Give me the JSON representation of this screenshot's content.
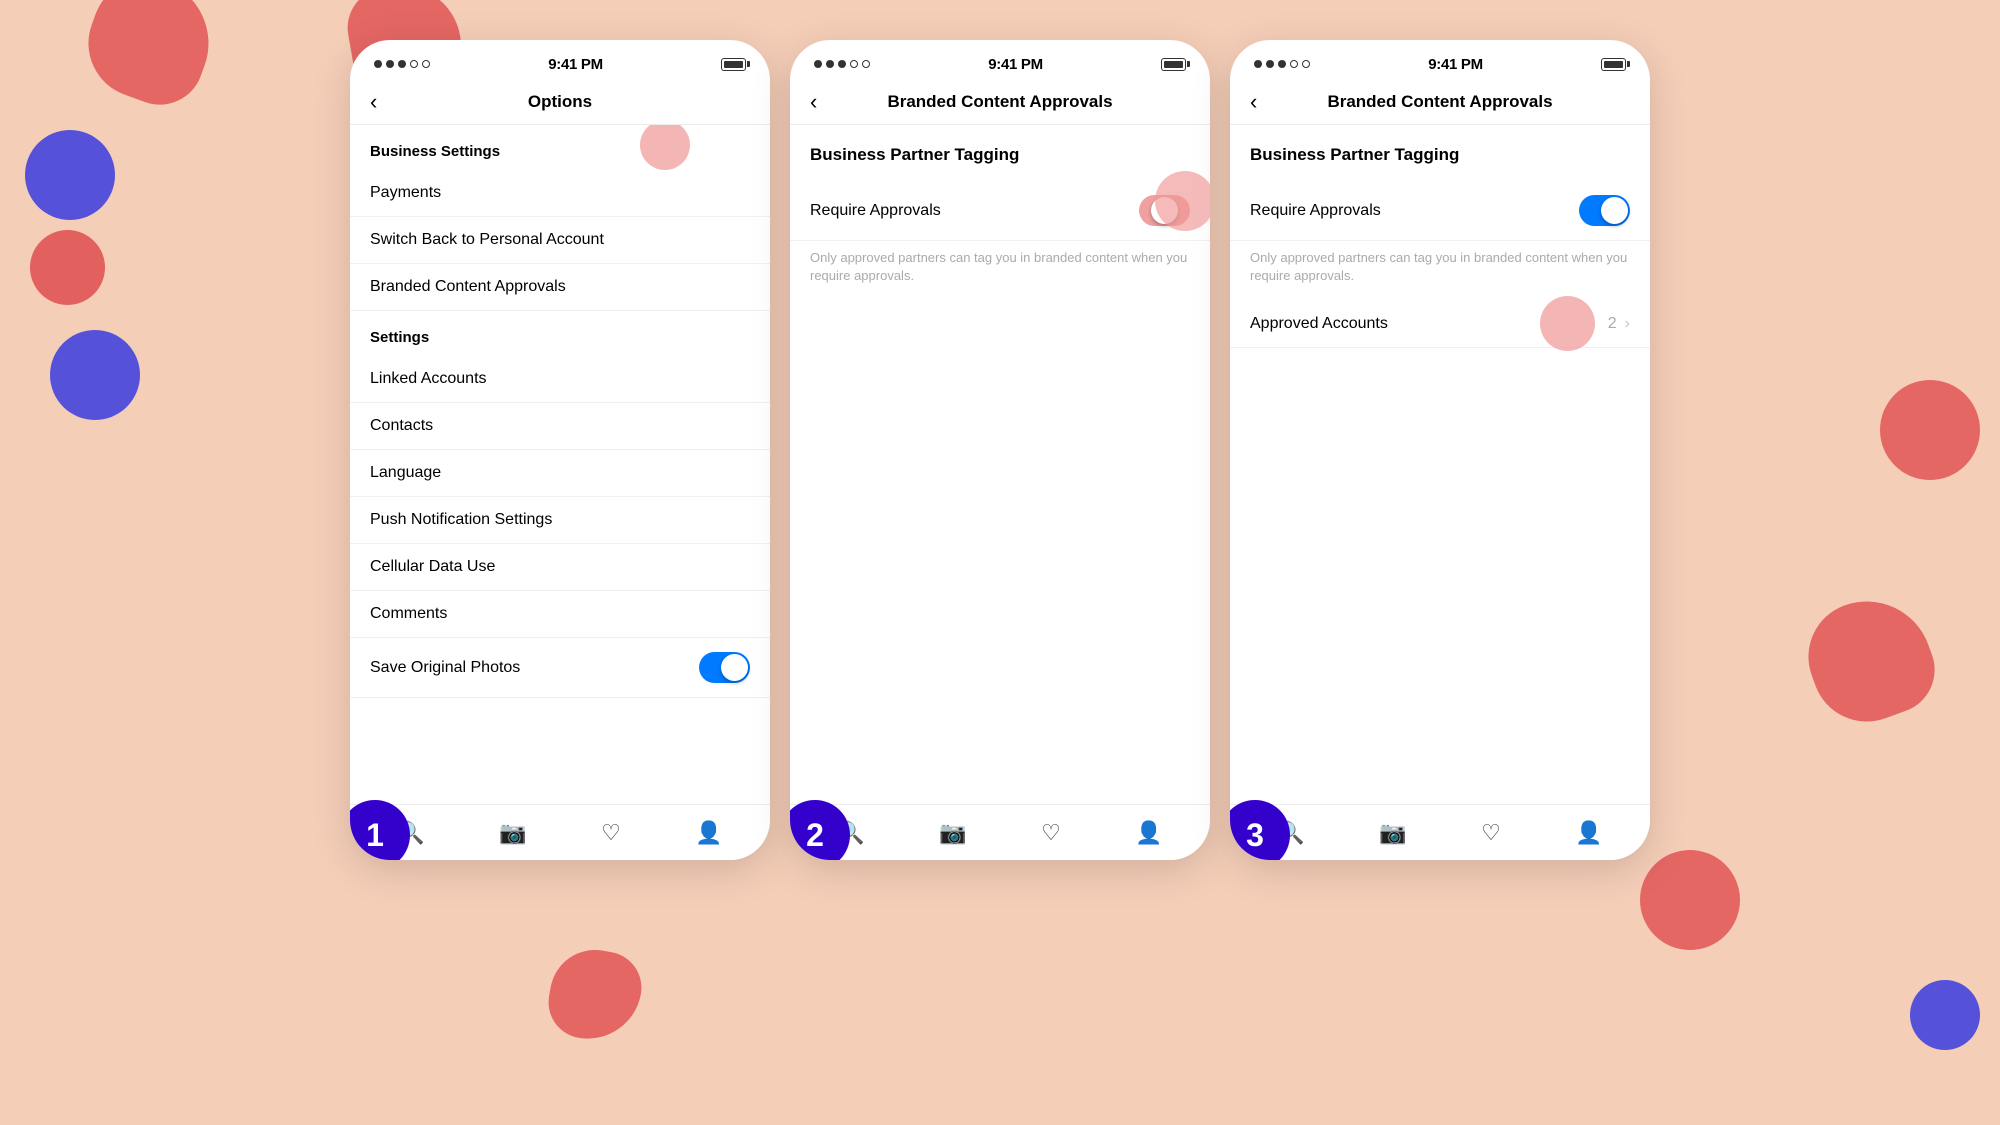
{
  "background": {
    "color": "#f5ceb8"
  },
  "phones": [
    {
      "id": "phone1",
      "step": "1",
      "statusBar": {
        "dots": [
          "filled",
          "filled",
          "filled",
          "empty",
          "empty"
        ],
        "time": "9:41 PM",
        "battery": "full"
      },
      "navTitle": "Options",
      "showBack": true,
      "sections": [
        {
          "type": "section-header",
          "label": "Business Settings"
        },
        {
          "type": "menu-item",
          "label": "Payments"
        },
        {
          "type": "menu-item",
          "label": "Switch Back to Personal Account"
        },
        {
          "type": "menu-item",
          "label": "Branded Content Approvals"
        },
        {
          "type": "section-header",
          "label": "Settings"
        },
        {
          "type": "menu-item",
          "label": "Linked Accounts"
        },
        {
          "type": "menu-item",
          "label": "Contacts"
        },
        {
          "type": "menu-item",
          "label": "Language"
        },
        {
          "type": "menu-item",
          "label": "Push Notification Settings"
        },
        {
          "type": "menu-item",
          "label": "Cellular Data Use"
        },
        {
          "type": "menu-item",
          "label": "Comments"
        },
        {
          "type": "menu-item-toggle",
          "label": "Save Original Photos",
          "toggleState": "on"
        }
      ],
      "tabBar": [
        "search",
        "camera",
        "heart",
        "person"
      ]
    },
    {
      "id": "phone2",
      "step": "2",
      "statusBar": {
        "dots": [
          "filled",
          "filled",
          "filled",
          "empty",
          "empty"
        ],
        "time": "9:41 PM",
        "battery": "full"
      },
      "navTitle": "Branded Content Approvals",
      "showBack": true,
      "bcaSectionTitle": "Business Partner Tagging",
      "requireApprovals": {
        "label": "Require Approvals",
        "toggleState": "half"
      },
      "description": "Only approved partners can tag you in branded content when you require approvals.",
      "tabBar": [
        "search",
        "camera",
        "heart",
        "person"
      ]
    },
    {
      "id": "phone3",
      "step": "3",
      "statusBar": {
        "dots": [
          "filled",
          "filled",
          "filled",
          "empty",
          "empty"
        ],
        "time": "9:41 PM",
        "battery": "full"
      },
      "navTitle": "Branded Content Approvals",
      "showBack": true,
      "bcaSectionTitle": "Business Partner Tagging",
      "requireApprovals": {
        "label": "Require Approvals",
        "toggleState": "on"
      },
      "description": "Only approved partners can tag you in branded content when you require approvals.",
      "approvedAccounts": {
        "label": "Approved Accounts",
        "count": "2"
      },
      "tabBar": [
        "search",
        "camera",
        "heart",
        "person"
      ]
    }
  ],
  "icons": {
    "search": "🔍",
    "camera": "📷",
    "heart": "♡",
    "person": "👤",
    "back": "‹"
  },
  "steps": [
    "1",
    "2",
    "3"
  ]
}
